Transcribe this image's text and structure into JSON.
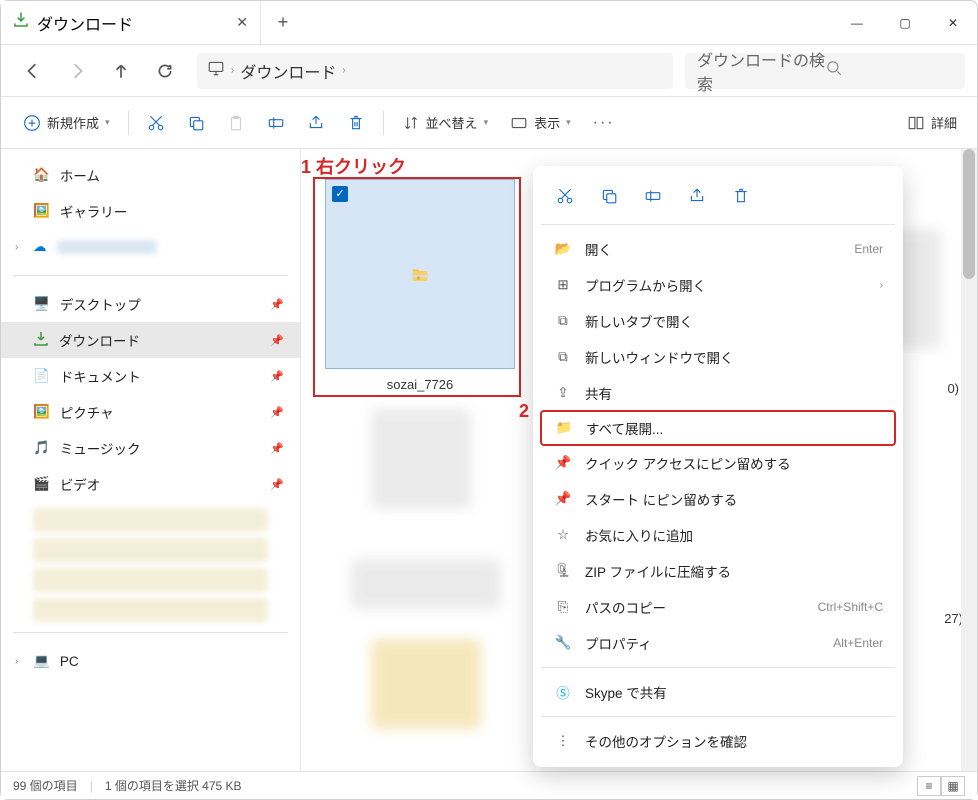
{
  "tab": {
    "title": "ダウンロード"
  },
  "breadcrumb": {
    "item": "ダウンロード"
  },
  "search": {
    "placeholder": "ダウンロードの検索"
  },
  "toolbar": {
    "new_label": "新規作成",
    "sort_label": "並べ替え",
    "view_label": "表示",
    "details_label": "詳細"
  },
  "sidebar": {
    "home": "ホーム",
    "gallery": "ギャラリー",
    "desktop": "デスクトップ",
    "downloads": "ダウンロード",
    "documents": "ドキュメント",
    "pictures": "ピクチャ",
    "music": "ミュージック",
    "videos": "ビデオ",
    "pc": "PC"
  },
  "file": {
    "name": "sozai_7726"
  },
  "annotations": {
    "label1": "1 右クリック",
    "label2": "2"
  },
  "ctx": {
    "open": "開く",
    "open_hint": "Enter",
    "program": "プログラムから開く",
    "newtab": "新しいタブで開く",
    "newwin": "新しいウィンドウで開く",
    "share": "共有",
    "extract": "すべて展開...",
    "pin_quick": "クイック アクセスにピン留めする",
    "pin_start": "スタート にピン留めする",
    "favorite": "お気に入りに追加",
    "zip": "ZIP ファイルに圧縮する",
    "copypath": "パスのコピー",
    "copypath_hint": "Ctrl+Shift+C",
    "props": "プロパティ",
    "props_hint": "Alt+Enter",
    "skype": "Skype で共有",
    "more": "その他のオプションを確認"
  },
  "status": {
    "count": "99 個の項目",
    "selected": "1 個の項目を選択 475 KB"
  },
  "bg_text": {
    "a": "0)",
    "b": "27)"
  }
}
